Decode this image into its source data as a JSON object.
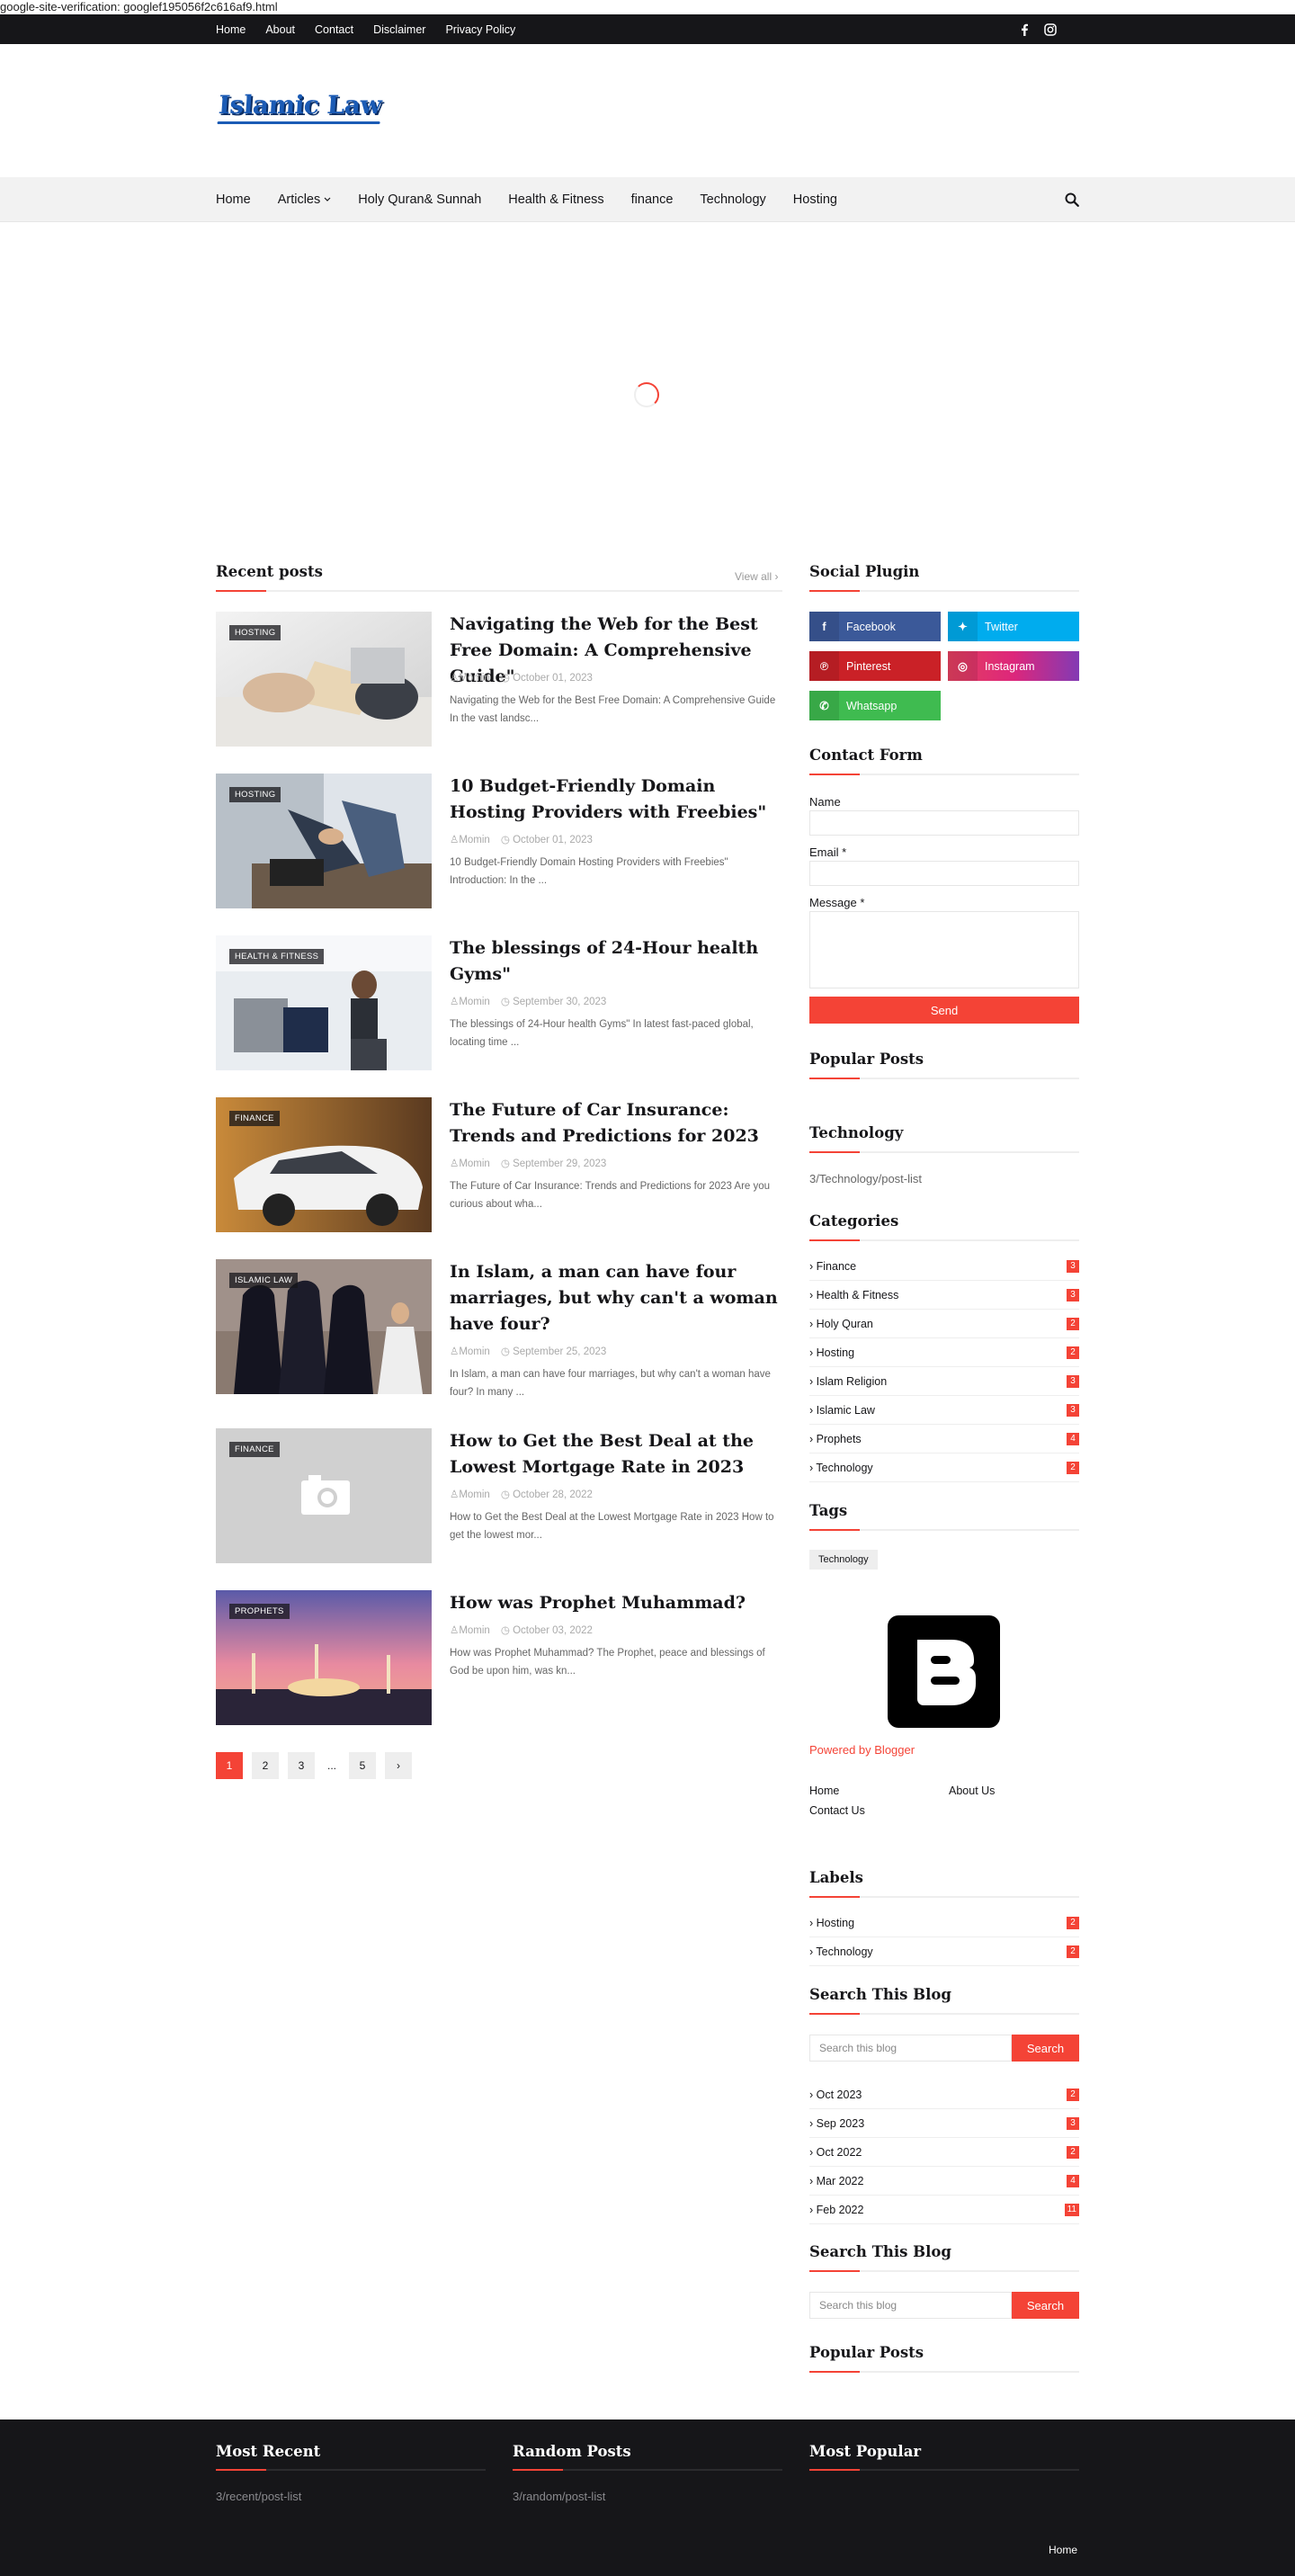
{
  "verification_text": "google-site-verification: googlef195056f2c616af9.html",
  "topbar": {
    "links": [
      "Home",
      "About",
      "Contact",
      "Disclaimer",
      "Privacy Policy"
    ],
    "social_icons": [
      "facebook-icon",
      "instagram-icon"
    ]
  },
  "logo_text": "Islamic Law",
  "nav": {
    "items": [
      "Home",
      "Articles",
      "Holy Quran& Sunnah",
      "Health & Fitness",
      "finance",
      "Technology",
      "Hosting"
    ]
  },
  "recent": {
    "title": "Recent posts",
    "view_all": "View all",
    "posts": [
      {
        "label": "HOSTING",
        "title": "Navigating the Web for the Best Free Domain: A Comprehensive Guide\"",
        "author": "Momin",
        "date": "October 01, 2023",
        "snippet": "Navigating the Web for the Best Free Domain: A Comprehensive Guide In the vast landsc..."
      },
      {
        "label": "HOSTING",
        "title": "10 Budget-Friendly Domain Hosting Providers with Freebies\"",
        "author": "Momin",
        "date": "October 01, 2023",
        "snippet": "10 Budget-Friendly Domain Hosting Providers with Freebies\" Introduction: In the ..."
      },
      {
        "label": "HEALTH & FITNESS",
        "title": "The blessings of 24-Hour health Gyms\"",
        "author": "Momin",
        "date": "September 30, 2023",
        "snippet": "The blessings of 24-Hour health Gyms\" In latest fast-paced global, locating time ..."
      },
      {
        "label": "FINANCE",
        "title": "The Future of Car Insurance: Trends and Predictions for 2023",
        "author": "Momin",
        "date": "September 29, 2023",
        "snippet": "The Future of Car Insurance: Trends and Predictions for 2023 Are you curious about wha..."
      },
      {
        "label": "ISLAMIC LAW",
        "title": "In Islam, a man can have four marriages, but why can't a woman have four?",
        "author": "Momin",
        "date": "September 25, 2023",
        "snippet": "In Islam, a man can have four marriages, but why can't a woman have four? In many ..."
      },
      {
        "label": "FINANCE",
        "title": "How to Get the Best Deal at the Lowest Mortgage Rate in 2023",
        "author": "Momin",
        "date": "October 28, 2022",
        "snippet": "How to Get the Best Deal at the Lowest Mortgage Rate in 2023 How to get the lowest mor..."
      },
      {
        "label": "PROPHETS",
        "title": "How was Prophet Muhammad?",
        "author": "Momin",
        "date": "October 03, 2022",
        "snippet": "How was Prophet Muhammad? The Prophet, peace and blessings of God be upon him, was kn..."
      }
    ]
  },
  "pagination": [
    "1",
    "2",
    "3",
    "...",
    "5",
    "›"
  ],
  "sidebar": {
    "social_title": "Social Plugin",
    "social": [
      {
        "name": "Facebook",
        "icon": "f",
        "color": "#3b5999"
      },
      {
        "name": "Twitter",
        "icon": "t",
        "color": "#00acee"
      },
      {
        "name": "Pinterest",
        "icon": "p",
        "color": "#ca2127"
      },
      {
        "name": "Instagram",
        "icon": "◎",
        "color": "#dd277b"
      },
      {
        "name": "Whatsapp",
        "icon": "w",
        "color": "#3fbb50"
      }
    ],
    "contact_title": "Contact Form",
    "contact": {
      "name_label": "Name",
      "email_label": "Email *",
      "message_label": "Message *",
      "send": "Send"
    },
    "popular_title": "Popular Posts",
    "tech_title": "Technology",
    "tech_text": "3/Technology/post-list",
    "categories_title": "Categories",
    "categories": [
      {
        "name": "Finance",
        "count": "3"
      },
      {
        "name": "Health & Fitness",
        "count": "3"
      },
      {
        "name": "Holy Quran",
        "count": "2"
      },
      {
        "name": "Hosting",
        "count": "2"
      },
      {
        "name": "Islam Religion",
        "count": "3"
      },
      {
        "name": "Islamic Law",
        "count": "3"
      },
      {
        "name": "Prophets",
        "count": "4"
      },
      {
        "name": "Technology",
        "count": "2"
      }
    ],
    "tags_title": "Tags",
    "tag": "Technology",
    "powered": "Powered by Blogger",
    "page_links": [
      "Home",
      "About Us",
      "Contact Us"
    ],
    "labels_title": "Labels",
    "labels": [
      {
        "name": "Hosting",
        "count": "2"
      },
      {
        "name": "Technology",
        "count": "2"
      }
    ],
    "search_title": "Search This Blog",
    "search_placeholder": "Search this blog",
    "search_button": "Search",
    "archive": [
      {
        "name": "Oct 2023",
        "count": "2"
      },
      {
        "name": "Sep 2023",
        "count": "3"
      },
      {
        "name": "Oct 2022",
        "count": "2"
      },
      {
        "name": "Mar 2022",
        "count": "4"
      },
      {
        "name": "Feb 2022",
        "count": "11"
      }
    ],
    "search_title_2": "Search This Blog",
    "popular_title_2": "Popular Posts"
  },
  "footer": {
    "most_recent": "Most Recent",
    "most_recent_text": "3/recent/post-list",
    "random": "Random Posts",
    "random_text": "3/random/post-list",
    "popular": "Most Popular",
    "home": "Home"
  }
}
